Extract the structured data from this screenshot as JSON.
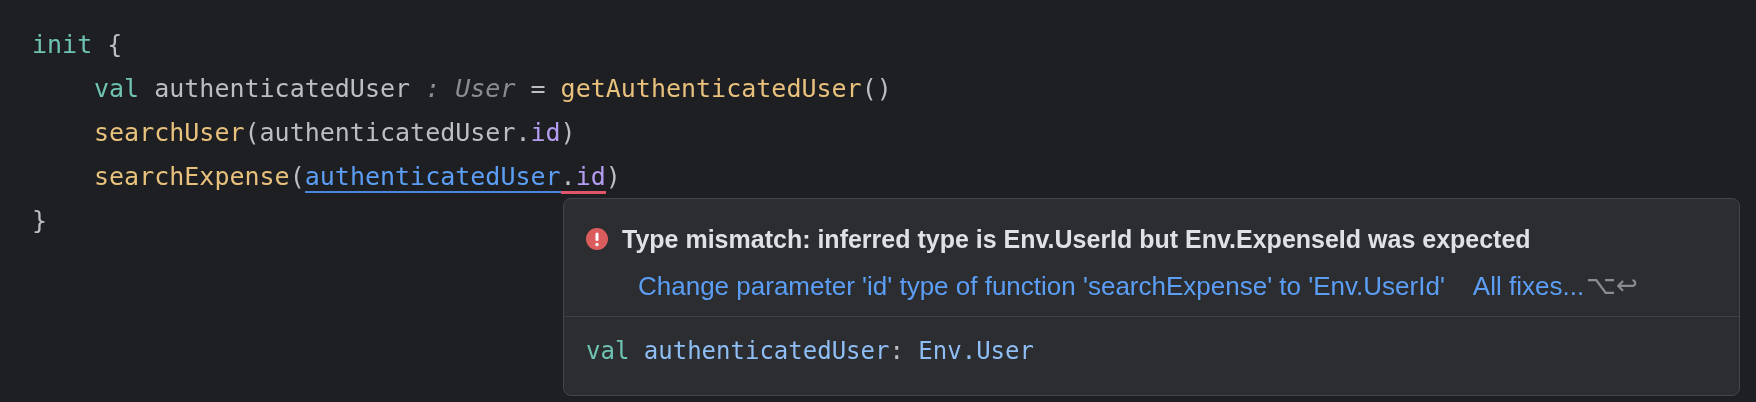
{
  "code": {
    "lines": [
      {
        "tokens": [
          {
            "text": "init",
            "kind": "keyword"
          },
          {
            "text": " {",
            "kind": "plain"
          }
        ],
        "children": [
          {
            "tokens": [
              {
                "text": "val",
                "kind": "keyword"
              },
              {
                "text": " authenticatedUser",
                "kind": "plain"
              },
              {
                "text": " : User",
                "kind": "hint"
              },
              {
                "text": " = ",
                "kind": "plain"
              },
              {
                "text": "getAuthenticatedUser",
                "kind": "function"
              },
              {
                "text": "()",
                "kind": "plain"
              }
            ]
          },
          {
            "tokens": [
              {
                "text": "searchUser",
                "kind": "function"
              },
              {
                "text": "(authenticatedUser.",
                "kind": "plain"
              },
              {
                "text": "id",
                "kind": "member"
              },
              {
                "text": ")",
                "kind": "plain"
              }
            ]
          },
          {
            "tokens": [
              {
                "text": "searchExpense",
                "kind": "function"
              },
              {
                "text": "(",
                "kind": "plain"
              },
              {
                "text": "authenticatedUser",
                "kind": "reference"
              },
              {
                "kind": "error",
                "children": [
                  {
                    "text": ".",
                    "kind": "plain"
                  },
                  {
                    "text": "id",
                    "kind": "member"
                  }
                ]
              },
              {
                "text": ")",
                "kind": "plain"
              }
            ]
          }
        ]
      },
      {
        "tokens": [
          {
            "text": "}",
            "kind": "plain"
          }
        ]
      }
    ]
  },
  "tooltip": {
    "message": "Type mismatch: inferred type is Env.UserId but Env.ExpenseId was expected",
    "fix": "Change parameter 'id' type of function 'searchExpense' to 'Env.UserId'",
    "all_fixes": "All fixes...",
    "shortcut": "⌥↩",
    "signature": [
      {
        "text": "val",
        "kind": "keyword"
      },
      {
        "text": " authenticatedUser",
        "kind": "declaration"
      },
      {
        "text": ": ",
        "kind": "plain"
      },
      {
        "text": "Env.User",
        "kind": "declaration"
      }
    ]
  }
}
